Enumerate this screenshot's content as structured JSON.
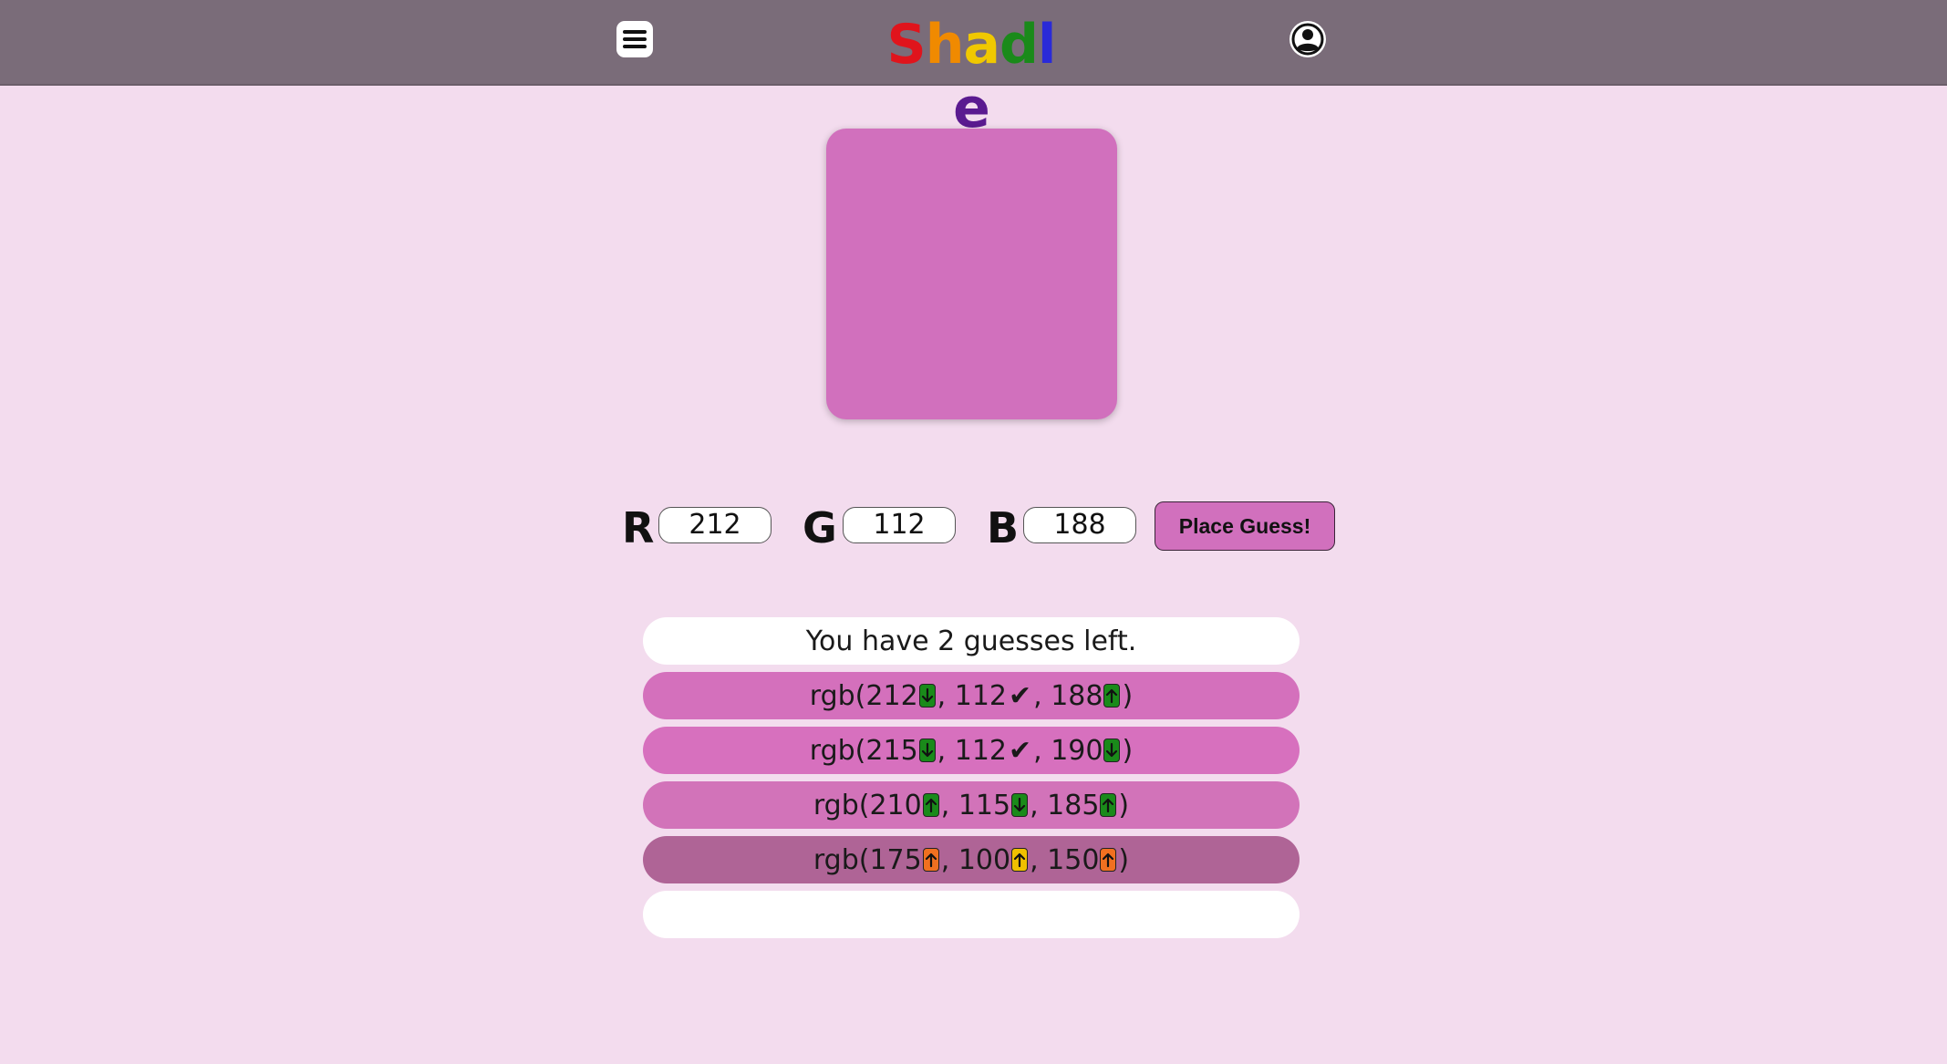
{
  "header": {
    "logo_letters": [
      {
        "char": "S",
        "color": "#e0141c"
      },
      {
        "char": "h",
        "color": "#f08a00"
      },
      {
        "char": "a",
        "color": "#f0c800"
      },
      {
        "char": "d",
        "color": "#1a8a1a"
      },
      {
        "char": "l",
        "color": "#2a2ad8"
      },
      {
        "char": "e",
        "color": "#5a1a90"
      }
    ],
    "menu_icon": "hamburger-icon",
    "account_icon": "account-circle-icon"
  },
  "target": {
    "color": "#d170bd"
  },
  "inputs": {
    "r_label": "R",
    "r_value": "212",
    "g_label": "G",
    "g_value": "112",
    "b_label": "B",
    "b_value": "188"
  },
  "place_button": {
    "label": "Place Guess!",
    "color": "#d170bd"
  },
  "status": "You have 2 guesses left.",
  "guesses": [
    {
      "color": "#d470bc",
      "channels": [
        {
          "value": "212",
          "hint": "down",
          "hint_color": "#1a8a1a"
        },
        {
          "value": "112",
          "hint": "correct",
          "hint_color": ""
        },
        {
          "value": "188",
          "hint": "up",
          "hint_color": "#1a8a1a"
        }
      ]
    },
    {
      "color": "#d770be",
      "channels": [
        {
          "value": "215",
          "hint": "down",
          "hint_color": "#1a8a1a"
        },
        {
          "value": "112",
          "hint": "correct",
          "hint_color": ""
        },
        {
          "value": "190",
          "hint": "down",
          "hint_color": "#1a8a1a"
        }
      ]
    },
    {
      "color": "#d273b9",
      "channels": [
        {
          "value": "210",
          "hint": "up",
          "hint_color": "#1a8a1a"
        },
        {
          "value": "115",
          "hint": "down",
          "hint_color": "#1a8a1a"
        },
        {
          "value": "185",
          "hint": "up",
          "hint_color": "#1a8a1a"
        }
      ]
    },
    {
      "color": "#af6496",
      "channels": [
        {
          "value": "175",
          "hint": "up",
          "hint_color": "#f07020"
        },
        {
          "value": "100",
          "hint": "up",
          "hint_color": "#f0c000"
        },
        {
          "value": "150",
          "hint": "up",
          "hint_color": "#f07020"
        }
      ]
    }
  ]
}
